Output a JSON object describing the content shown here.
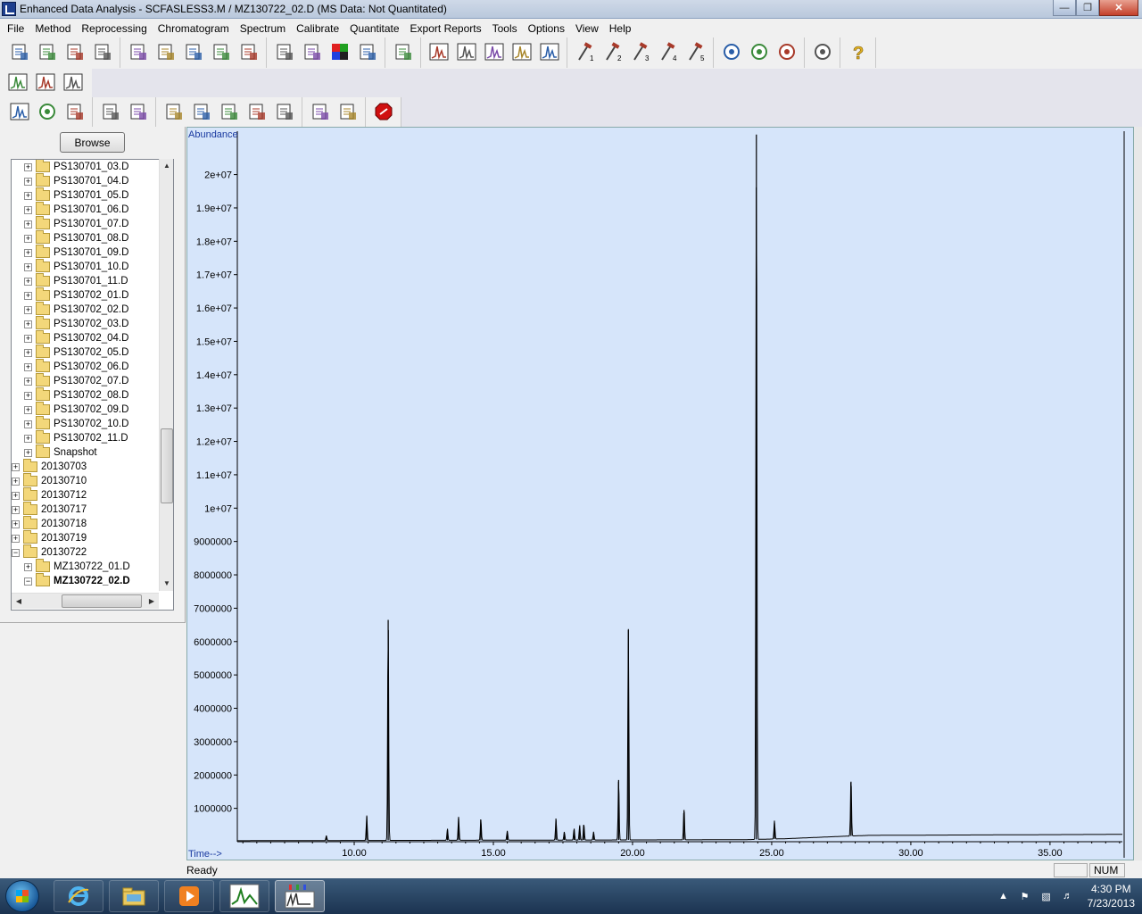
{
  "window": {
    "title": "Enhanced Data Analysis - SCFASLESS3.M / MZ130722_02.D    (MS Data: Not Quantitated)",
    "controls": [
      "minimize",
      "maximize",
      "close"
    ]
  },
  "menu": {
    "items": [
      "File",
      "Method",
      "Reprocessing",
      "Chromatogram",
      "Spectrum",
      "Calibrate",
      "Quantitate",
      "Export Reports",
      "Tools",
      "Options",
      "View",
      "Help"
    ]
  },
  "toolbar": {
    "row1_icons": [
      "load-data-icon",
      "select-data-icon",
      "snapshot-icon",
      "print-icon",
      "load-method-icon",
      "save-method-icon",
      "edit-method-icon",
      "sim-add-icon",
      "sim-to-scan-icon",
      "copy-icon",
      "tile-window-icon",
      "color-palette-icon",
      "layout-icon",
      "report-icon",
      "spectrum-view-icon",
      "edit-spectrum-icon",
      "peak-shape-icon",
      "peak-list-icon",
      "spectrum-trace-icon",
      "macro-1-icon",
      "macro-2-icon",
      "macro-3-icon",
      "macro-4-icon",
      "macro-5-icon",
      "library-search-icon",
      "library-list-icon",
      "compound-search-icon",
      "navigator-icon",
      "help-icon"
    ],
    "row2_icons": [
      "integrate-icon",
      "peak-compare-icon",
      "chromatogram-scale-icon"
    ],
    "row3_icons": [
      "integrate-chrom-icon",
      "library-icon",
      "bank-icon",
      "baseline-icon",
      "ratio-check-icon",
      "calibration-update-icon",
      "quant-add-icon",
      "quant-copy-icon",
      "quant-edit-icon",
      "quant-report-icon",
      "summary-report-icon",
      "report-edit-icon",
      "stop-icon"
    ]
  },
  "browser": {
    "browse_label": "Browse",
    "tree": [
      {
        "label": "PS130701_03.D",
        "level": 2,
        "expander": "+"
      },
      {
        "label": "PS130701_04.D",
        "level": 2,
        "expander": "+"
      },
      {
        "label": "PS130701_05.D",
        "level": 2,
        "expander": "+"
      },
      {
        "label": "PS130701_06.D",
        "level": 2,
        "expander": "+"
      },
      {
        "label": "PS130701_07.D",
        "level": 2,
        "expander": "+"
      },
      {
        "label": "PS130701_08.D",
        "level": 2,
        "expander": "+"
      },
      {
        "label": "PS130701_09.D",
        "level": 2,
        "expander": "+"
      },
      {
        "label": "PS130701_10.D",
        "level": 2,
        "expander": "+"
      },
      {
        "label": "PS130701_11.D",
        "level": 2,
        "expander": "+"
      },
      {
        "label": "PS130702_01.D",
        "level": 2,
        "expander": "+"
      },
      {
        "label": "PS130702_02.D",
        "level": 2,
        "expander": "+"
      },
      {
        "label": "PS130702_03.D",
        "level": 2,
        "expander": "+"
      },
      {
        "label": "PS130702_04.D",
        "level": 2,
        "expander": "+"
      },
      {
        "label": "PS130702_05.D",
        "level": 2,
        "expander": "+"
      },
      {
        "label": "PS130702_06.D",
        "level": 2,
        "expander": "+"
      },
      {
        "label": "PS130702_07.D",
        "level": 2,
        "expander": "+"
      },
      {
        "label": "PS130702_08.D",
        "level": 2,
        "expander": "+"
      },
      {
        "label": "PS130702_09.D",
        "level": 2,
        "expander": "+"
      },
      {
        "label": "PS130702_10.D",
        "level": 2,
        "expander": "+"
      },
      {
        "label": "PS130702_11.D",
        "level": 2,
        "expander": "+"
      },
      {
        "label": "Snapshot",
        "level": 2,
        "expander": "+"
      },
      {
        "label": "20130703",
        "level": 1,
        "expander": "+"
      },
      {
        "label": "20130710",
        "level": 1,
        "expander": "+"
      },
      {
        "label": "20130712",
        "level": 1,
        "expander": "+"
      },
      {
        "label": "20130717",
        "level": 1,
        "expander": "+"
      },
      {
        "label": "20130718",
        "level": 1,
        "expander": "+"
      },
      {
        "label": "20130719",
        "level": 1,
        "expander": "+"
      },
      {
        "label": "20130722",
        "level": 1,
        "expander": "-"
      },
      {
        "label": "MZ130722_01.D",
        "level": 2,
        "expander": "+"
      },
      {
        "label": "MZ130722_02.D",
        "level": 2,
        "expander": "-",
        "bold": true
      }
    ]
  },
  "chart_data": {
    "type": "line",
    "ylabel": "Abundance",
    "xlabel": "Time-->",
    "xlim": [
      5.8,
      37.6
    ],
    "ylim": [
      0,
      21300000
    ],
    "yticks": [
      {
        "v": 1000000,
        "label": "1000000"
      },
      {
        "v": 2000000,
        "label": "2000000"
      },
      {
        "v": 3000000,
        "label": "3000000"
      },
      {
        "v": 4000000,
        "label": "4000000"
      },
      {
        "v": 5000000,
        "label": "5000000"
      },
      {
        "v": 6000000,
        "label": "6000000"
      },
      {
        "v": 7000000,
        "label": "7000000"
      },
      {
        "v": 8000000,
        "label": "8000000"
      },
      {
        "v": 9000000,
        "label": "9000000"
      },
      {
        "v": 10000000,
        "label": "1e+07"
      },
      {
        "v": 11000000,
        "label": "1.1e+07"
      },
      {
        "v": 12000000,
        "label": "1.2e+07"
      },
      {
        "v": 13000000,
        "label": "1.3e+07"
      },
      {
        "v": 14000000,
        "label": "1.4e+07"
      },
      {
        "v": 15000000,
        "label": "1.5e+07"
      },
      {
        "v": 16000000,
        "label": "1.6e+07"
      },
      {
        "v": 17000000,
        "label": "1.7e+07"
      },
      {
        "v": 18000000,
        "label": "1.8e+07"
      },
      {
        "v": 19000000,
        "label": "1.9e+07"
      },
      {
        "v": 20000000,
        "label": "2e+07"
      }
    ],
    "xticks": [
      {
        "v": 10.0,
        "label": "10.00"
      },
      {
        "v": 15.0,
        "label": "15.00"
      },
      {
        "v": 20.0,
        "label": "20.00"
      },
      {
        "v": 25.0,
        "label": "25.00"
      },
      {
        "v": 30.0,
        "label": "30.00"
      },
      {
        "v": 35.0,
        "label": "35.00"
      }
    ],
    "peaks": [
      {
        "t": 9.0,
        "a": 150000
      },
      {
        "t": 10.45,
        "a": 750000
      },
      {
        "t": 11.22,
        "a": 6650000
      },
      {
        "t": 13.35,
        "a": 350000
      },
      {
        "t": 13.75,
        "a": 700000
      },
      {
        "t": 14.55,
        "a": 650000
      },
      {
        "t": 15.5,
        "a": 280000
      },
      {
        "t": 17.25,
        "a": 650000
      },
      {
        "t": 17.55,
        "a": 250000
      },
      {
        "t": 17.9,
        "a": 350000
      },
      {
        "t": 18.1,
        "a": 450000
      },
      {
        "t": 18.25,
        "a": 500000
      },
      {
        "t": 18.6,
        "a": 250000
      },
      {
        "t": 19.5,
        "a": 1850000
      },
      {
        "t": 19.85,
        "a": 6350000
      },
      {
        "t": 21.85,
        "a": 950000
      },
      {
        "t": 24.45,
        "a": 21200000
      },
      {
        "t": 25.1,
        "a": 550000
      },
      {
        "t": 27.85,
        "a": 1800000
      }
    ],
    "baseline": [
      {
        "t": 5.8,
        "a": 30000
      },
      {
        "t": 24.0,
        "a": 60000
      },
      {
        "t": 25.5,
        "a": 90000
      },
      {
        "t": 27.5,
        "a": 160000
      },
      {
        "t": 28.5,
        "a": 190000
      },
      {
        "t": 37.6,
        "a": 220000
      }
    ]
  },
  "status": {
    "text": "Ready",
    "num": "NUM"
  },
  "taskbar": {
    "time": "4:30 PM",
    "date": "7/23/2013"
  }
}
